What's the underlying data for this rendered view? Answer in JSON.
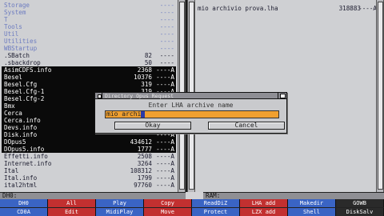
{
  "left_pane": {
    "rows": [
      {
        "name": "Storage",
        "size": "",
        "prot": "----",
        "kind": "dir"
      },
      {
        "name": "System",
        "size": "",
        "prot": "----",
        "kind": "dir"
      },
      {
        "name": "T",
        "size": "",
        "prot": "----",
        "kind": "dir"
      },
      {
        "name": "Tools",
        "size": "",
        "prot": "----",
        "kind": "dir"
      },
      {
        "name": "Util",
        "size": "",
        "prot": "----",
        "kind": "dir"
      },
      {
        "name": "Utilities",
        "size": "",
        "prot": "----",
        "kind": "dir"
      },
      {
        "name": "WBStartup",
        "size": "",
        "prot": "----",
        "kind": "dir"
      },
      {
        "name": ".SBatch",
        "size": "82",
        "prot": "----",
        "kind": "file"
      },
      {
        "name": ".sbackdrop",
        "size": "50",
        "prot": "----",
        "kind": "file"
      },
      {
        "name": "AsimCDFS.info",
        "size": "2368",
        "prot": "----A",
        "kind": "sel"
      },
      {
        "name": "Besel",
        "size": "10376",
        "prot": "----A",
        "kind": "sel"
      },
      {
        "name": "Besel.Cfg",
        "size": "319",
        "prot": "----A",
        "kind": "sel"
      },
      {
        "name": "Besel.Cfg-1",
        "size": "319",
        "prot": "----A",
        "kind": "sel"
      },
      {
        "name": "Besel.Cfg-2",
        "size": "319",
        "prot": "----A",
        "kind": "sel"
      },
      {
        "name": "Bmx",
        "size": "",
        "prot": "----A",
        "kind": "sel"
      },
      {
        "name": "Cerca",
        "size": "",
        "prot": "----A",
        "kind": "sel"
      },
      {
        "name": "Cerca.info",
        "size": "",
        "prot": "----A",
        "kind": "sel"
      },
      {
        "name": "Devs.info",
        "size": "",
        "prot": "----A",
        "kind": "sel"
      },
      {
        "name": "Disk.info",
        "size": "",
        "prot": "----A",
        "kind": "sel"
      },
      {
        "name": "DOpus5",
        "size": "434612",
        "prot": "----A",
        "kind": "sel"
      },
      {
        "name": "DOpus5.info",
        "size": "1777",
        "prot": "----A",
        "kind": "sel"
      },
      {
        "name": "Effetti.info",
        "size": "2508",
        "prot": "----A",
        "kind": "file"
      },
      {
        "name": "Internet.info",
        "size": "3264",
        "prot": "----A",
        "kind": "file"
      },
      {
        "name": "Ital",
        "size": "108312",
        "prot": "----A",
        "kind": "file"
      },
      {
        "name": "Ital.info",
        "size": "1799",
        "prot": "----A",
        "kind": "file"
      },
      {
        "name": "ital2html",
        "size": "97760",
        "prot": "----A",
        "kind": "file"
      }
    ],
    "path": "DH0:"
  },
  "right_pane": {
    "rows": [
      {
        "name": "mio archivio prova.lha",
        "size": "318883",
        "prot": "----A"
      }
    ],
    "path": "RAM:"
  },
  "dialog": {
    "title": "Directory Opus Request",
    "message": "Enter LHA archive name",
    "input_value": "mio archi",
    "ok_label": "Okay",
    "cancel_label": "Cancel"
  },
  "buttons": [
    {
      "label": "DH0",
      "color": "#3a64c4"
    },
    {
      "label": "All",
      "color": "#c23030"
    },
    {
      "label": "Play",
      "color": "#3a64c4"
    },
    {
      "label": "Copy",
      "color": "#c23030"
    },
    {
      "label": "ReadDiZ",
      "color": "#3a64c4"
    },
    {
      "label": "LHA add",
      "color": "#c23030"
    },
    {
      "label": "Makedir",
      "color": "#3a64c4"
    },
    {
      "label": "GOWB",
      "color": "#2a2a2a"
    },
    {
      "label": "CD0A",
      "color": "#3a64c4"
    },
    {
      "label": "Edit",
      "color": "#c23030"
    },
    {
      "label": "MidiPlay",
      "color": "#3a64c4"
    },
    {
      "label": "Move",
      "color": "#c23030"
    },
    {
      "label": "Protect",
      "color": "#3a64c4"
    },
    {
      "label": "LZX add",
      "color": "#c23030"
    },
    {
      "label": "Shell",
      "color": "#3a64c4"
    },
    {
      "label": "DiskSalv",
      "color": "#2a2a2a"
    }
  ]
}
